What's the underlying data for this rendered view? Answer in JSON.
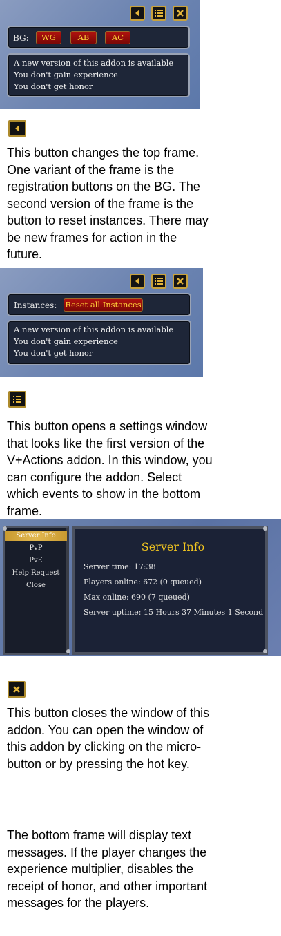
{
  "frame1": {
    "bg_label": "BG:",
    "bg_buttons": [
      "WG",
      "AB",
      "AC"
    ],
    "messages": [
      "A new version of this addon is available",
      "You don't gain experience",
      "You don't get honor"
    ]
  },
  "para1": "This button changes the top frame. One variant of the frame is the registration buttons on the BG. The second version of the frame is the button to reset instances. There may be new frames for action in the future.",
  "frame2": {
    "instances_label": "Instances:",
    "reset_button": "Reset all Instances",
    "messages": [
      "A new version of this addon is available",
      "You don't gain experience",
      "You don't get honor"
    ]
  },
  "para2": "This button opens a settings window that looks like the first version of the V+Actions addon. In this window, you can configure the addon. Select which events to show in the bottom frame.",
  "settings": {
    "menu": [
      "Server Info",
      "PvP",
      "PvE",
      "Help Request",
      "Close"
    ],
    "title": "Server Info",
    "lines": [
      "Server time: 17:38",
      "Players online: 672 (0 queued)",
      "Max online: 690 (7 queued)",
      "Server uptime: 15 Hours 37 Minutes 1 Second"
    ]
  },
  "para3": "This button closes the window of this addon. You can open the window of this addon by clicking on the micro-button or by pressing the hot key.",
  "para4": "The bottom frame will display text messages. If the player changes the experience multiplier, disables the receipt of honor, and other important messages for the players.",
  "colors": {
    "frame_bg": "#6f86b2",
    "gold_border": "#c8a23c",
    "red_button": "#9a0e0a",
    "yellow_text": "#ffd23a",
    "title_gold": "#f0c420"
  },
  "icons": [
    "arrow-left-icon",
    "list-icon",
    "close-icon"
  ]
}
